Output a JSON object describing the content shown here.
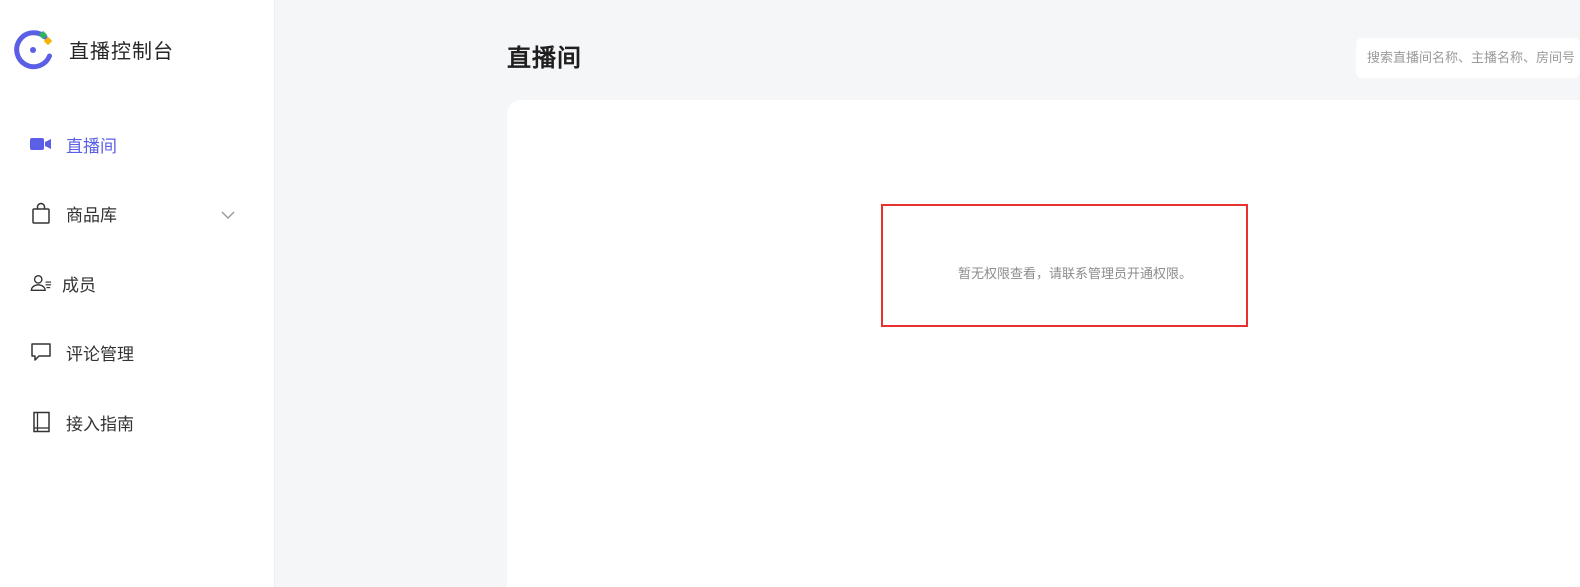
{
  "app": {
    "title": "直播控制台"
  },
  "sidebar": {
    "items": [
      {
        "label": "直播间",
        "icon": "video-camera-icon",
        "active": true
      },
      {
        "label": "商品库",
        "icon": "shopping-bag-icon",
        "expandable": true
      },
      {
        "label": "成员",
        "icon": "members-icon"
      },
      {
        "label": "评论管理",
        "icon": "comment-icon"
      },
      {
        "label": "接入指南",
        "icon": "book-icon"
      }
    ]
  },
  "main": {
    "title": "直播间",
    "search": {
      "placeholder": "搜索直播间名称、主播名称、房间号"
    },
    "empty_message": "暂无权限查看，请联系管理员开通权限。"
  },
  "colors": {
    "accent": "#5b5fe6",
    "highlight": "#e8312f",
    "logo_green": "#2db55d",
    "logo_yellow": "#f5b400"
  }
}
